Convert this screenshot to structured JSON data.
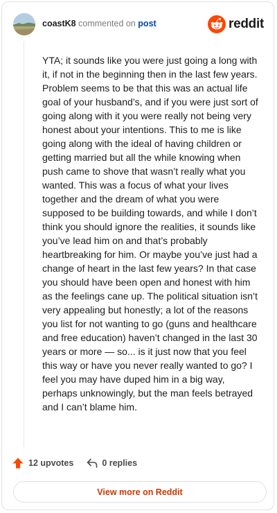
{
  "header": {
    "username": "coastK8",
    "action": "commented on",
    "post_link": "post",
    "brand": "reddit"
  },
  "comment": {
    "text": "YTA; it sounds like you were just going a long with it, if not in the beginning then in the last few years. Problem seems to be that this was an actual life goal of your husband’s, and if you were just sort of going along with it you were really not being very honest about your intentions. This to me is like going along with the ideal of having children or getting married but all the while knowing when push came to shove that wasn’t really what you wanted. This was a focus of what your lives together and the dream of what you were supposed to be building towards, and while I don’t think you should ignore the realities, it sounds like you’ve lead him on and that’s probably heartbreaking for him. Or maybe you’ve just had a change of heart in the last few years? In that case you should have been open and honest with him as the feelings cane up. The political situation isn’t very appealing but honestly; a lot of the reasons you list for not wanting to go (guns and healthcare and free education) haven’t changed in the last 30 years or more — so... is it just now that you feel this way or have you never really wanted to go? I feel you may have duped him in a big way, perhaps unknowingly, but the man feels betrayed and I can’t blame him."
  },
  "footer": {
    "upvotes": "12 upvotes",
    "replies": "0 replies",
    "view_more": "View more on Reddit"
  },
  "colors": {
    "brand_orange": "#ff4500",
    "link_blue": "#0045ac",
    "view_more_text": "#cc3700"
  },
  "icons": {
    "upvote": "upvote-arrow-icon",
    "reply": "reply-arrow-icon",
    "brand": "reddit-snoo-icon"
  }
}
